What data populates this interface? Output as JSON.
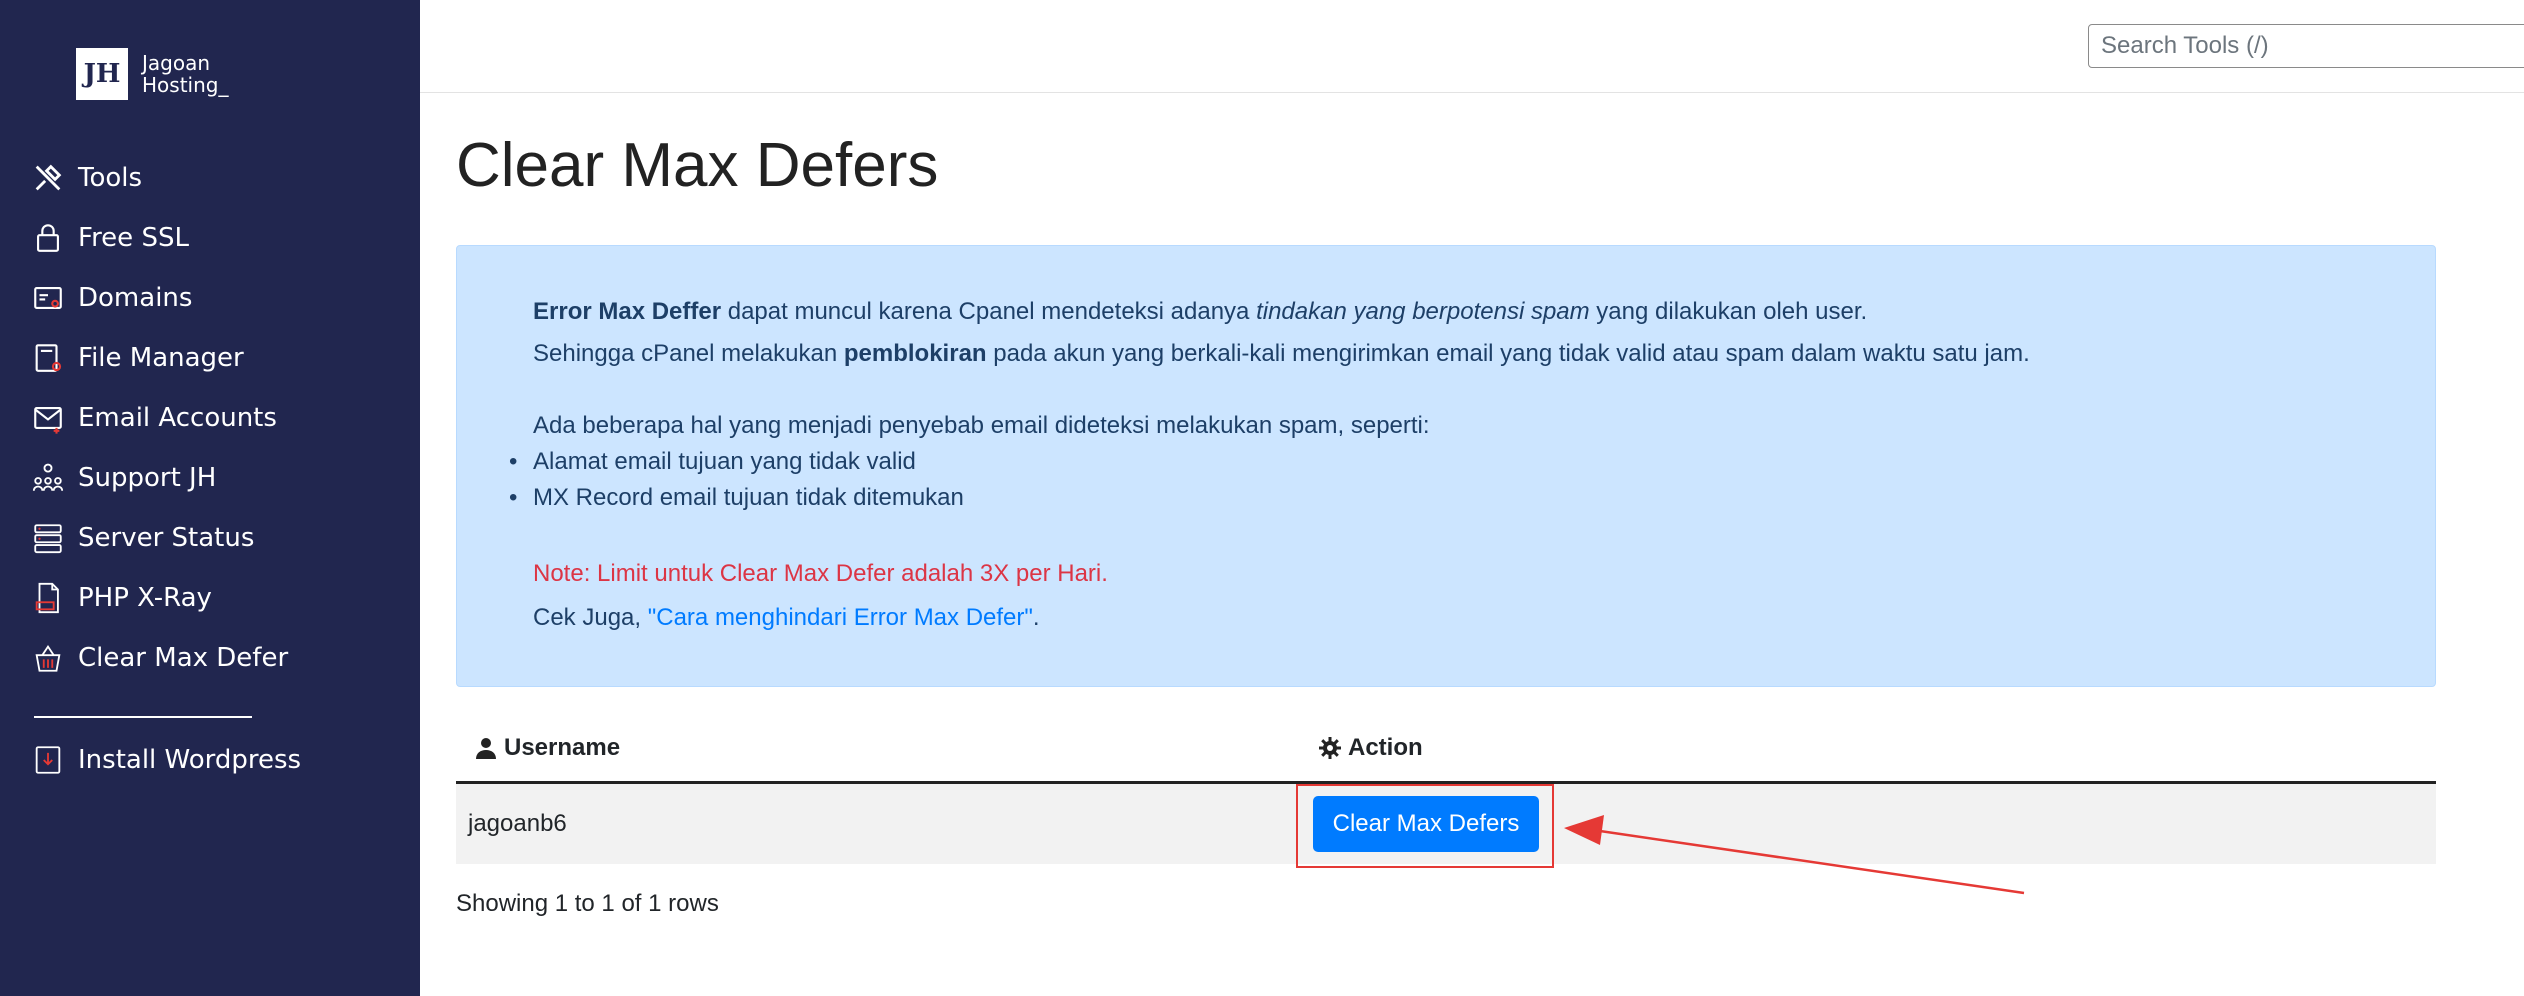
{
  "brand": {
    "logo_mark": "JH",
    "line1": "Jagoan",
    "line2": "Hosting_"
  },
  "sidebar": {
    "items": [
      {
        "label": "Tools",
        "icon": "tools-icon"
      },
      {
        "label": "Free SSL",
        "icon": "lock-icon"
      },
      {
        "label": "Domains",
        "icon": "domain-icon"
      },
      {
        "label": "File Manager",
        "icon": "file-manager-icon"
      },
      {
        "label": "Email Accounts",
        "icon": "email-icon"
      },
      {
        "label": "Support JH",
        "icon": "support-icon"
      },
      {
        "label": "Server Status",
        "icon": "server-icon"
      },
      {
        "label": "PHP X-Ray",
        "icon": "php-file-icon"
      },
      {
        "label": "Clear Max Defer",
        "icon": "basket-icon"
      }
    ],
    "extra": {
      "label": "Install Wordpress",
      "icon": "install-icon"
    }
  },
  "search": {
    "placeholder": "Search Tools (/)"
  },
  "page": {
    "title": "Clear Max Defers"
  },
  "alert": {
    "line1_bold": "Error Max Deffer",
    "line1_a": " dapat muncul karena Cpanel mendeteksi adanya ",
    "line1_italic": "tindakan yang berpotensi spam",
    "line1_b": " yang dilakukan oleh user.",
    "line2_a": "Sehingga cPanel melakukan ",
    "line2_bold": "pemblokiran",
    "line2_b": " pada akun yang berkali-kali mengirimkan email yang tidak valid atau spam dalam waktu satu jam.",
    "line3": "Ada beberapa hal yang menjadi penyebab email dideteksi melakukan spam, seperti:",
    "bullets": [
      "Alamat email tujuan yang tidak valid",
      "MX Record email tujuan tidak ditemukan"
    ],
    "note": "Note: Limit untuk Clear Max Defer adalah 3X per Hari.",
    "see_also_prefix": "Cek Juga, ",
    "see_also_link": "\"Cara menghindari Error Max Defer\"",
    "see_also_suffix": "."
  },
  "table": {
    "headers": {
      "username": "Username",
      "action": "Action"
    },
    "rows": [
      {
        "username": "jagoanb6",
        "action_label": "Clear Max Defers"
      }
    ],
    "footer": "Showing 1 to 1 of 1 rows"
  },
  "colors": {
    "sidebar_bg": "#21264f",
    "alert_bg": "#cce5ff",
    "primary": "#007bff",
    "note": "#dc3545",
    "annotation": "#e53935"
  }
}
